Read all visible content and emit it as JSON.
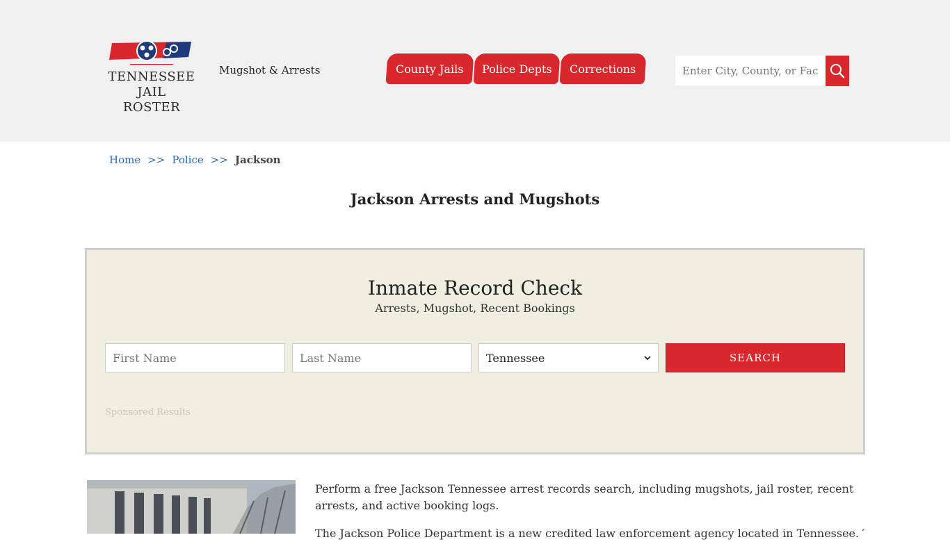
{
  "header": {
    "logo_line1": "TENNESSEE",
    "logo_line2": "JAIL ROSTER",
    "tagline": "Mugshot & Arrests",
    "nav": [
      {
        "label": "County Jails"
      },
      {
        "label": "Police Depts"
      },
      {
        "label": "Corrections"
      }
    ],
    "search_placeholder": "Enter City, County, or Facility",
    "brand_color": "#d9272e"
  },
  "breadcrumb": {
    "home": "Home",
    "police": "Police",
    "current": "Jackson",
    "separator": ">>"
  },
  "page_title": "Jackson Arrests and Mugshots",
  "record_check": {
    "title": "Inmate Record Check",
    "subtitle": "Arrests, Mugshot, Recent Bookings",
    "first_name_placeholder": "First Name",
    "last_name_placeholder": "Last Name",
    "state_selected": "Tennessee",
    "search_label": "SEARCH",
    "sponsored": "Sponsored Results"
  },
  "content": {
    "intro": "Perform a free Jackson Tennessee arrest records search, including mugshots, jail roster, recent arrests, and active booking logs.",
    "intro2": "The Jackson Police Department is a new credited law enforcement agency located in Tennessee. The"
  }
}
